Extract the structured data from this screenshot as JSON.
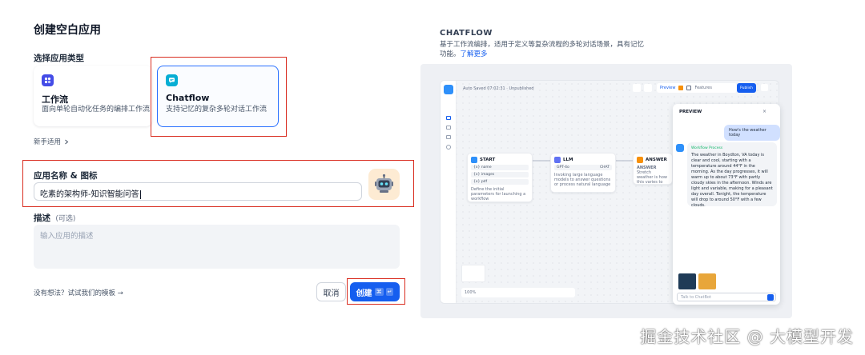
{
  "dialog": {
    "title": "创建空白应用",
    "type_label": "选择应用类型",
    "types": [
      {
        "title": "工作流",
        "desc": "面向单轮自动化任务的编排工作流"
      },
      {
        "title": "Chatflow",
        "desc": "支持记忆的复杂多轮对话工作流"
      }
    ],
    "beginner_link": "新手适用",
    "name_label": "应用名称 & 图标",
    "name_value": "吃素的架构师-知识智能问答",
    "desc_label": "描述",
    "desc_optional": "(可选)",
    "desc_placeholder": "输入应用的描述",
    "no_idea": "没有想法？试试我们的模板 →",
    "cancel": "取消",
    "create": "创建",
    "kbd_cmd": "⌘",
    "kbd_enter": "↵"
  },
  "info": {
    "title": "CHATFLOW",
    "desc": "基于工作流编排，适用于定义等复杂流程的多轮对话场景，具有记忆功能。",
    "learn_more": "了解更多"
  },
  "screenshot": {
    "header_text": "Auto Saved 07:02:31 · Unpublished",
    "toolbar": {
      "preview": "Preview",
      "features": "Features",
      "publish": "Publish"
    },
    "nodes": {
      "start": {
        "title": "START",
        "vars": [
          "{x} name",
          "{x} images",
          "{x} pdf"
        ],
        "desc": "Define the initial parameters for launching a workflow"
      },
      "llm": {
        "title": "LLM",
        "model": "GPT-4o",
        "tag": "CHAT",
        "desc": "Invoking large language models to answer questions or process natural language"
      },
      "answer": {
        "title": "ANSWER",
        "label": "ANSWER",
        "desc": "Stretch weather is how this varies to extend."
      }
    },
    "preview": {
      "title": "PREVIEW",
      "user_msg": "How's the weather today",
      "process": "Workflow Process",
      "ai_reply": "The weather in Boydton, VA today is clear and cool, starting with a temperature around 44°F in the morning. As the day progresses, it will warm up to about 73°F with partly cloudy skies in the afternoon. Winds are light and variable, making for a pleasant day overall. Tonight, the temperature will drop to around 50°F with a few clouds.",
      "input_placeholder": "Talk to ChatBot"
    },
    "zoom": "100%"
  },
  "watermark": "掘金技术社区 @ 大模型开发",
  "colors": {
    "accent": "#155eef",
    "highlight": "#d92d20"
  }
}
